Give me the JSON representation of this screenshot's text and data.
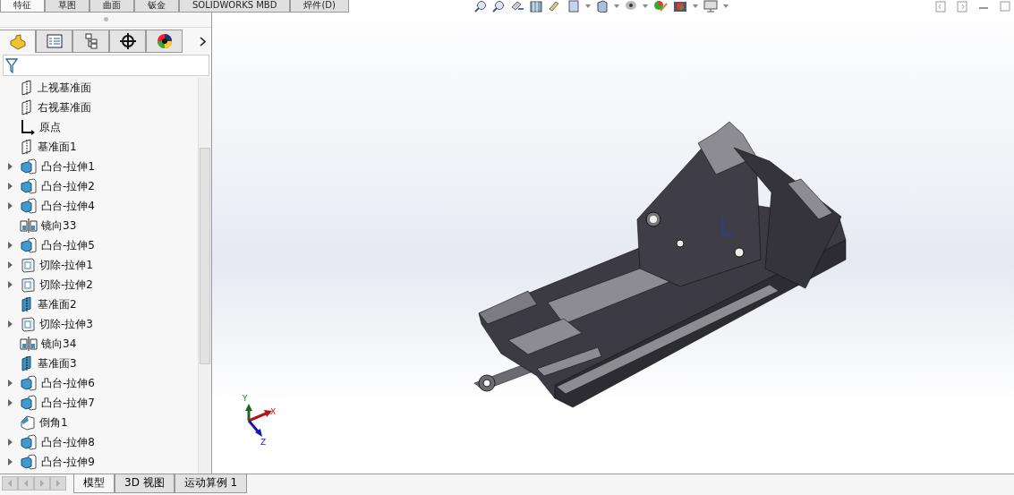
{
  "ribbon_tabs": [
    {
      "label": "特征",
      "selected": true
    },
    {
      "label": "草图",
      "selected": false
    },
    {
      "label": "曲面",
      "selected": false
    },
    {
      "label": "钣金",
      "selected": false
    },
    {
      "label": "SOLIDWORKS MBD",
      "selected": false
    },
    {
      "label": "焊件(D)",
      "selected": false
    }
  ],
  "panel_tabs": [
    {
      "kind": "feature",
      "selected": true
    },
    {
      "kind": "property",
      "selected": false
    },
    {
      "kind": "config",
      "selected": false
    },
    {
      "kind": "dimxpert",
      "selected": false
    },
    {
      "kind": "display",
      "selected": false
    }
  ],
  "tree": {
    "items": [
      {
        "kind": "plane",
        "label": "上视基准面",
        "expandable": false
      },
      {
        "kind": "plane",
        "label": "右视基准面",
        "expandable": false
      },
      {
        "kind": "origin",
        "label": "原点",
        "expandable": false
      },
      {
        "kind": "plane",
        "label": "基准面1",
        "expandable": false
      },
      {
        "kind": "boss",
        "label": "凸台-拉伸1",
        "expandable": true
      },
      {
        "kind": "boss",
        "label": "凸台-拉伸2",
        "expandable": true
      },
      {
        "kind": "boss",
        "label": "凸台-拉伸4",
        "expandable": true
      },
      {
        "kind": "mirror",
        "label": "镜向33",
        "expandable": false
      },
      {
        "kind": "boss",
        "label": "凸台-拉伸5",
        "expandable": true
      },
      {
        "kind": "cut",
        "label": "切除-拉伸1",
        "expandable": true
      },
      {
        "kind": "cut",
        "label": "切除-拉伸2",
        "expandable": true
      },
      {
        "kind": "plane-solid",
        "label": "基准面2",
        "expandable": false
      },
      {
        "kind": "cut",
        "label": "切除-拉伸3",
        "expandable": true
      },
      {
        "kind": "mirror",
        "label": "镜向34",
        "expandable": false
      },
      {
        "kind": "plane-solid",
        "label": "基准面3",
        "expandable": false
      },
      {
        "kind": "boss",
        "label": "凸台-拉伸6",
        "expandable": true
      },
      {
        "kind": "boss",
        "label": "凸台-拉伸7",
        "expandable": true
      },
      {
        "kind": "chamfer",
        "label": "倒角1",
        "expandable": false
      },
      {
        "kind": "boss",
        "label": "凸台-拉伸8",
        "expandable": true
      },
      {
        "kind": "boss",
        "label": "凸台-拉伸9",
        "expandable": true
      }
    ]
  },
  "bottom_tabs": [
    {
      "label": "模型",
      "selected": true
    },
    {
      "label": "3D 视图",
      "selected": false
    },
    {
      "label": "运动算例 1",
      "selected": false
    }
  ],
  "triad": {
    "y": "Y",
    "x": "X",
    "z": "Z"
  }
}
